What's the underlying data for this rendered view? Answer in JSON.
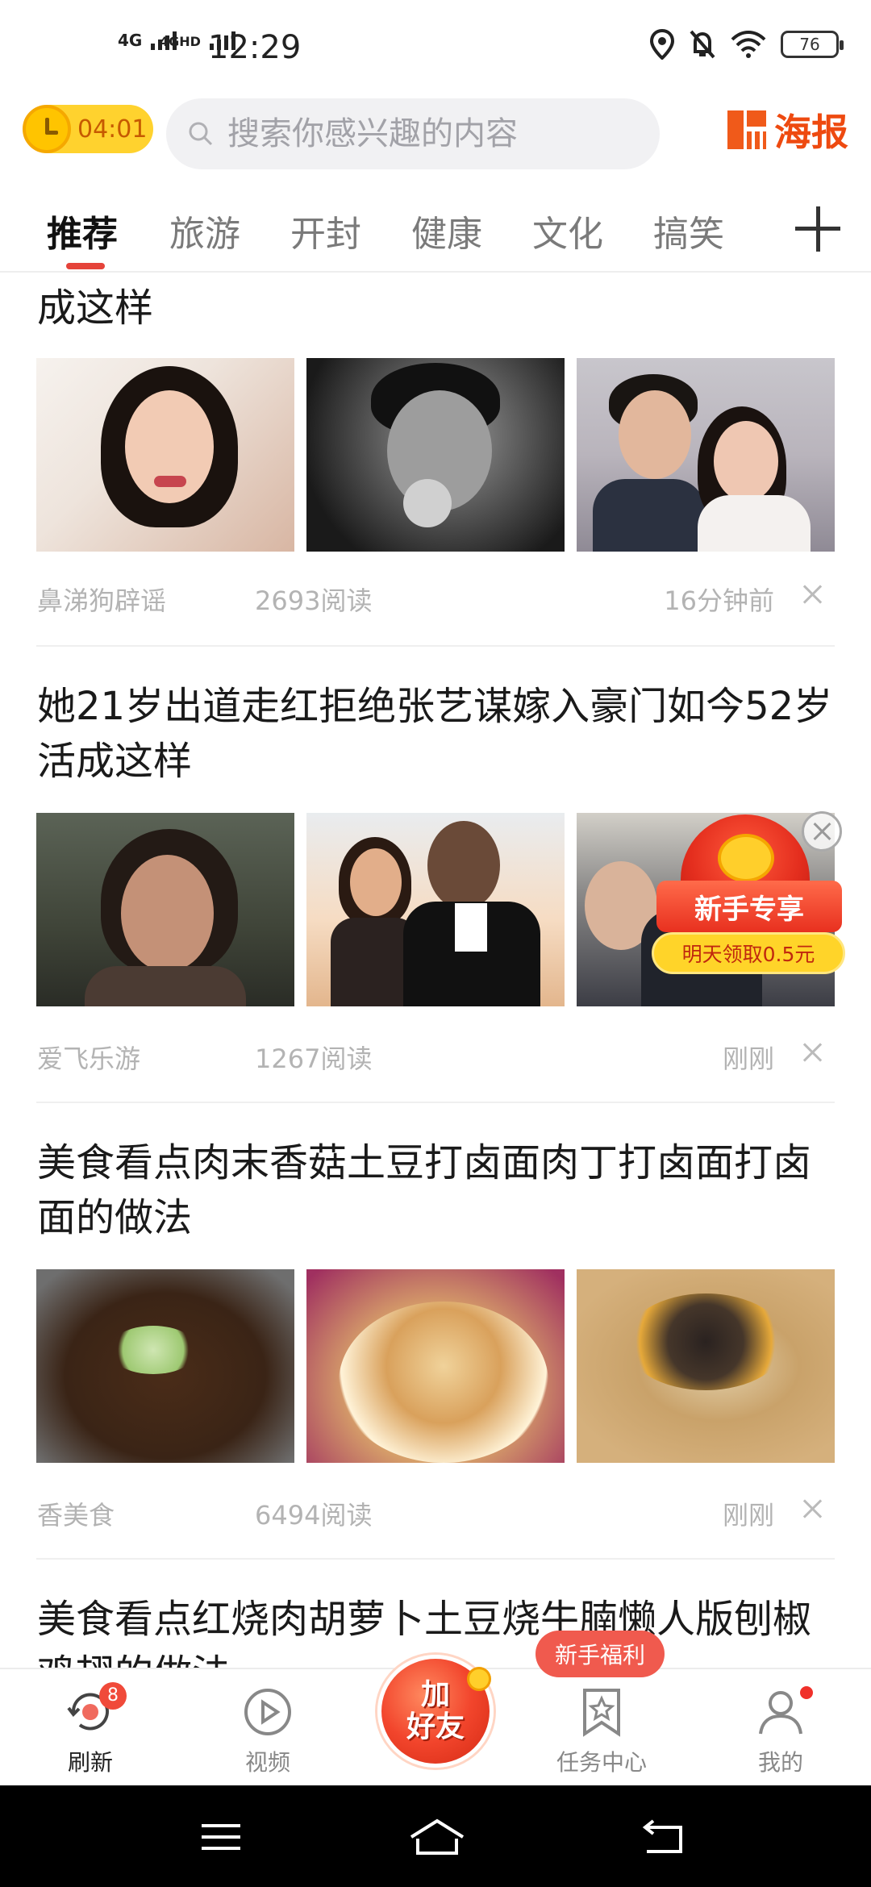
{
  "status_bar": {
    "network_1": "4G",
    "network_2": "4GHD",
    "time": "12:29",
    "battery": "76",
    "icons": [
      "location-icon",
      "mute-bell-icon",
      "wifi-icon",
      "battery-icon"
    ]
  },
  "header": {
    "timer": "04:01",
    "search_placeholder": "搜索你感兴趣的内容",
    "poster_label": "海报"
  },
  "tabs": [
    {
      "label": "推荐",
      "active": true
    },
    {
      "label": "旅游",
      "active": false
    },
    {
      "label": "开封",
      "active": false
    },
    {
      "label": "健康",
      "active": false
    },
    {
      "label": "文化",
      "active": false
    },
    {
      "label": "搞笑",
      "active": false
    }
  ],
  "feed": [
    {
      "title": "成这样",
      "source": "鼻涕狗辟谣",
      "reads": "2693阅读",
      "time": "16分钟前"
    },
    {
      "title": "她21岁出道走红拒绝张艺谋嫁入豪门如今52岁活成这样",
      "source": "爱飞乐游",
      "reads": "1267阅读",
      "time": "刚刚"
    },
    {
      "title": "美食看点肉末香菇土豆打卤面肉丁打卤面打卤面的做法",
      "source": "香美食",
      "reads": "6494阅读",
      "time": "刚刚"
    },
    {
      "title": "美食看点红烧肉胡萝卜土豆烧牛腩懒人版刨椒鸡翅的做法"
    }
  ],
  "promo": {
    "title": "新手专享",
    "subtitle": "明天领取0.5元"
  },
  "bottom_nav": {
    "refresh": "刷新",
    "refresh_badge": "8",
    "video": "视频",
    "add_friend_top": "加",
    "add_friend_bottom": "好友",
    "welfare_bubble": "新手福利",
    "tasks": "任务中心",
    "mine": "我的"
  },
  "colors": {
    "accent": "#e5433a",
    "poster": "#ee4a10",
    "timer_bg": "#ffd22e"
  }
}
